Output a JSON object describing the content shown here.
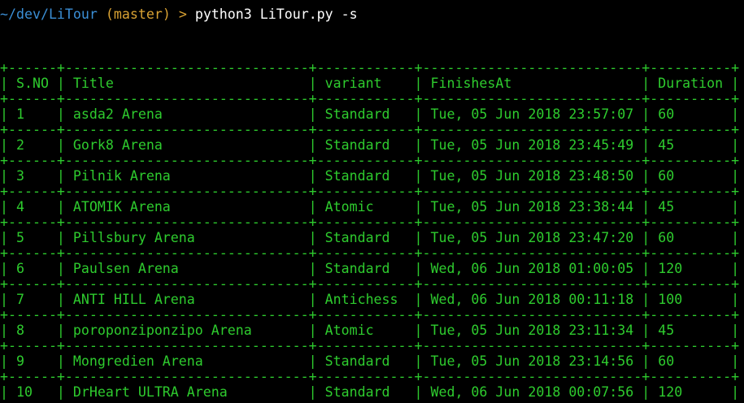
{
  "prompt": {
    "path": "~/dev/LiTour",
    "branch": "(master)",
    "arrow": ">",
    "command": "python3 LiTour.py -s"
  },
  "colors": {
    "background": "#000000",
    "path": "#3b8fd6",
    "branch": "#d9a233",
    "command": "#ffffff",
    "table": "#2ecb2e"
  },
  "table": {
    "separator": "+------+------------------------------+------------+---------------------------+----------+",
    "headers": [
      "S.NO",
      "Title",
      "variant",
      "FinishesAt",
      "Duration"
    ],
    "rows": [
      [
        "1",
        "asda2 Arena",
        "Standard",
        "Tue, 05 Jun 2018 23:57:07",
        "60"
      ],
      [
        "2",
        "Gork8 Arena",
        "Standard",
        "Tue, 05 Jun 2018 23:45:49",
        "45"
      ],
      [
        "3",
        "Pilnik Arena",
        "Standard",
        "Tue, 05 Jun 2018 23:48:50",
        "60"
      ],
      [
        "4",
        "ATOMIK Arena",
        "Atomic",
        "Tue, 05 Jun 2018 23:38:44",
        "45"
      ],
      [
        "5",
        "Pillsbury Arena",
        "Standard",
        "Tue, 05 Jun 2018 23:47:20",
        "60"
      ],
      [
        "6",
        "Paulsen Arena",
        "Standard",
        "Wed, 06 Jun 2018 01:00:05",
        "120"
      ],
      [
        "7",
        "ANTI HILL Arena",
        "Antichess",
        "Wed, 06 Jun 2018 00:11:18",
        "100"
      ],
      [
        "8",
        "poroponziponzipo Arena",
        "Atomic",
        "Tue, 05 Jun 2018 23:11:34",
        "45"
      ],
      [
        "9",
        "Mongredien Arena",
        "Standard",
        "Tue, 05 Jun 2018 23:14:56",
        "60"
      ],
      [
        "10",
        "DrHeart ULTRA Arena",
        "Standard",
        "Wed, 06 Jun 2018 00:07:56",
        "120"
      ]
    ]
  }
}
